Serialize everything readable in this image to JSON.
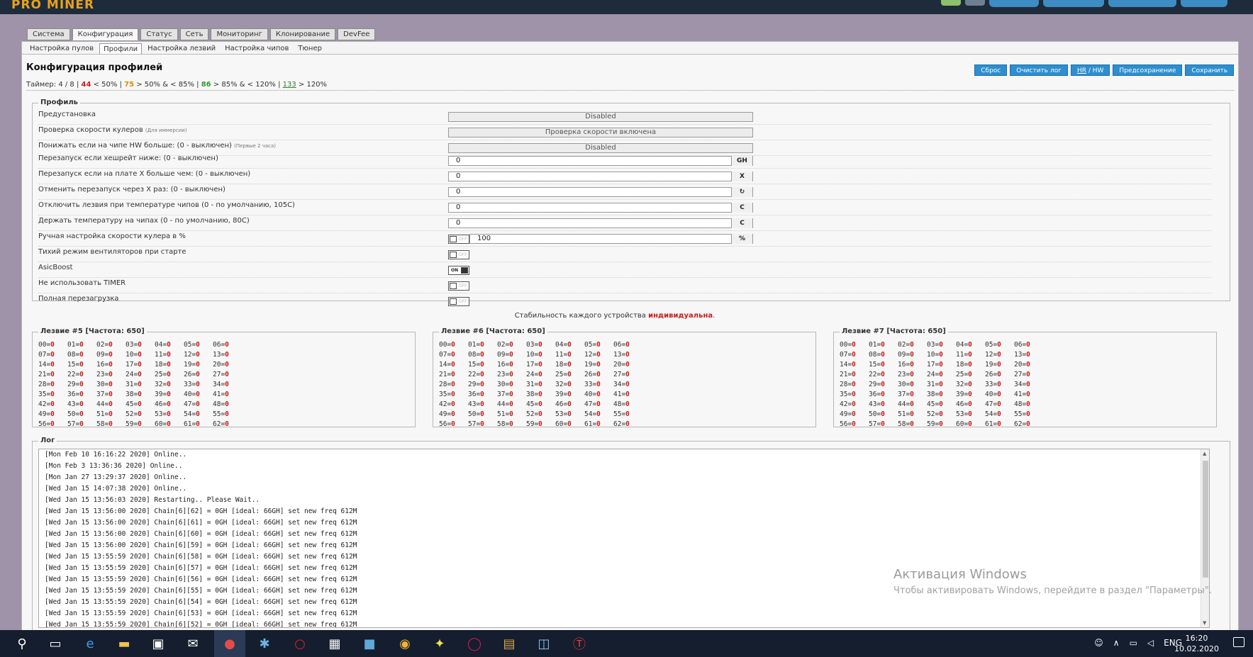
{
  "app": {
    "logo": "PRO MINER"
  },
  "tabs_main": [
    "Система",
    "Конфигурация",
    "Статус",
    "Сеть",
    "Мониторинг",
    "Клонирование",
    "DevFee"
  ],
  "tabs_sub": [
    "Настройка пулов",
    "Профили",
    "Настройка лезвий",
    "Настройка чипов",
    "Тюнер"
  ],
  "page_title": "Конфигурация профилей",
  "buttons": {
    "reset": "Сброс",
    "clear_log": "Очистить лог",
    "hr": "HR",
    "hw_sep": " / ",
    "hw": "HW",
    "presave": "Предсохранение",
    "save": "Сохранить"
  },
  "timer": {
    "label": "Таймер: 4 / 8 | ",
    "v1": "44",
    "t1": " < 50% | ",
    "v2": "75",
    "t2": " > 50% & < 85% | ",
    "v3": "86",
    "t3": " > 85% & < 120% | ",
    "v4": "133",
    "t4": " > 120%"
  },
  "profile": {
    "legend": "Профиль",
    "preset_label": "Предустановка",
    "preset_value": "Disabled",
    "fan_check_label": "Проверка скорости кулеров",
    "fan_check_hint": "(Для иммерсии)",
    "fan_check_value": "Проверка скорости включена",
    "lower_hw_label": "Понижать если на чипе HW больше: (0 - выключен)",
    "lower_hw_hint": "(Первые 2 часа)",
    "lower_hw_value": "Disabled",
    "restart_hash_label": "Перезапуск если хешрейт ниже: (0 - выключен)",
    "restart_hash_value": "0",
    "restart_hash_unit": "GH",
    "restart_x_label": "Перезапуск если на плате X больше чем: (0 - выключен)",
    "restart_x_value": "0",
    "restart_x_unit": "X",
    "cancel_restart_label": "Отменить перезапуск через X раз: (0 - выключен)",
    "cancel_restart_value": "0",
    "cancel_restart_unit": "↻",
    "disable_temp_label": "Отключить лезвия при температуре чипов (0 - по умолчанию, 105C)",
    "disable_temp_value": "0",
    "disable_temp_unit": "C",
    "hold_temp_label": "Держать температуру на чипах (0 - по умолчанию, 80C)",
    "hold_temp_value": "0",
    "hold_temp_unit": "C",
    "manual_fan_label": "Ручная настройка скорости кулера в %",
    "manual_fan_value": "100",
    "manual_fan_unit": "%",
    "quiet_fans_label": "Тихий режим вентиляторов при старте",
    "asicboost_label": "AsicBoost",
    "no_timer_label": "Не использовать TIMER",
    "full_reboot_label": "Полная перезагрузка",
    "toggle_off_text": "OFF",
    "toggle_on_text": "ON",
    "stability_prefix": "Стабильность каждого устройства ",
    "stability_value": "индивидуальна",
    "stability_suffix": "."
  },
  "blades": [
    {
      "legend": "Лезвие #5 [Частота: 650]"
    },
    {
      "legend": "Лезвие #6 [Частота: 650]"
    },
    {
      "legend": "Лезвие #7 [Частота: 650]"
    }
  ],
  "chip_value": "0",
  "log": {
    "legend": "Лог",
    "lines": [
      "[Mon Feb 10 16:16:22 2020] Online..",
      "[Mon Feb  3 13:36:36 2020] Online..",
      "[Mon Jan 27 13:29:37 2020] Online..",
      "[Wed Jan 15 14:07:38 2020] Online..",
      "[Wed Jan 15 13:56:03 2020] Restarting.. Please Wait..",
      "[Wed Jan 15 13:56:00 2020] Chain[6][62] = 0GH [ideal: 66GH] set new freq 612M",
      "[Wed Jan 15 13:56:00 2020] Chain[6][61] = 0GH [ideal: 66GH] set new freq 612M",
      "[Wed Jan 15 13:56:00 2020] Chain[6][60] = 0GH [ideal: 66GH] set new freq 612M",
      "[Wed Jan 15 13:56:00 2020] Chain[6][59] = 0GH [ideal: 66GH] set new freq 612M",
      "[Wed Jan 15 13:55:59 2020] Chain[6][58] = 0GH [ideal: 66GH] set new freq 612M",
      "[Wed Jan 15 13:55:59 2020] Chain[6][57] = 0GH [ideal: 66GH] set new freq 612M",
      "[Wed Jan 15 13:55:59 2020] Chain[6][56] = 0GH [ideal: 66GH] set new freq 612M",
      "[Wed Jan 15 13:55:59 2020] Chain[6][55] = 0GH [ideal: 66GH] set new freq 612M",
      "[Wed Jan 15 13:55:59 2020] Chain[6][54] = 0GH [ideal: 66GH] set new freq 612M",
      "[Wed Jan 15 13:55:59 2020] Chain[6][53] = 0GH [ideal: 66GH] set new freq 612M",
      "[Wed Jan 15 13:55:59 2020] Chain[6][52] = 0GH [ideal: 66GH] set new freq 612M"
    ]
  },
  "watermark": {
    "line1": "Активация Windows",
    "line2": "Чтобы активировать Windows, перейдите в раздел \"Параметры\"."
  },
  "taskbar": {
    "lang": "ENG",
    "time": "16:20",
    "date": "10.02.2020"
  },
  "colors": {
    "accent": "#2d8fcf",
    "bad": "#c81d1d",
    "warn": "#e08a00",
    "ok": "#2f9b2f"
  }
}
